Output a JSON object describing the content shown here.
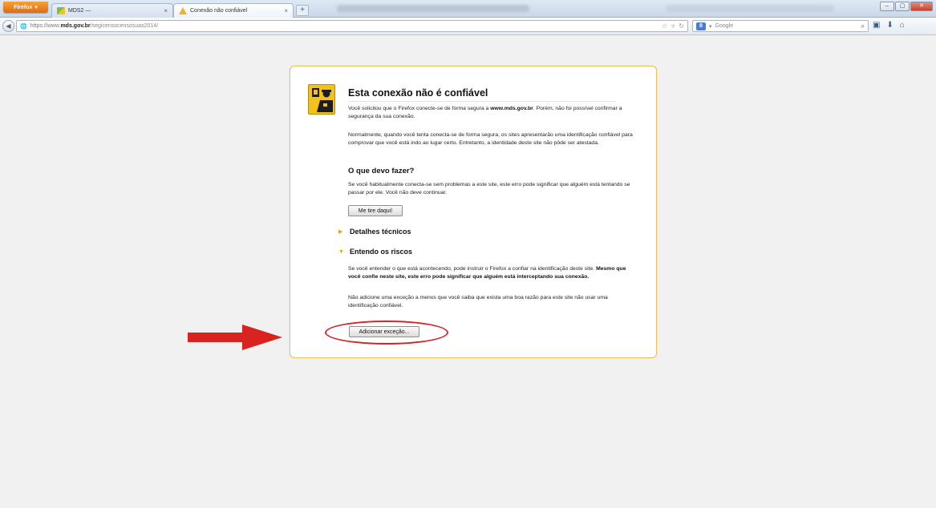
{
  "browser": {
    "menu_button": "Firefox",
    "tabs": [
      {
        "title": "MDS2 —",
        "close": "×"
      },
      {
        "title": "Conexão não confiável",
        "close": "×"
      }
    ],
    "new_tab": "+",
    "url": {
      "scheme": "https://www.",
      "host": "mds.gov.br",
      "path": "/segicensocensosuas2014/"
    },
    "search": {
      "engine": "Google"
    },
    "window_controls": {
      "minimize": "–",
      "maximize": "▢",
      "close": "✕"
    }
  },
  "error_page": {
    "title": "Esta conexão não é confiável",
    "intro_part1": "Você solicitou que o Firefox conecte-se de forma segura a ",
    "intro_domain": "www.mds.gov.br",
    "intro_part2": ". Porém, não foi possível confirmar a segurança da sua conexão.",
    "explanation": "Normalmente, quando você tenta conecta-se de forma segura, os sites apresentarão uma identificação confiável para comprovar que você está indo ao lugar certo. Entretanto, a identidade deste site não pôde ser atestada.",
    "what_heading": "O que devo fazer?",
    "what_text": "Se você habitualmente conecta-se sem problemas a este site, este erro pode significar que alguém está tentando se passar por ele. Você não deve continuar.",
    "get_me_out_button": "Me tire daqui!",
    "technical_details_label": "Detalhes técnicos",
    "understand_risks_label": "Entendo os riscos",
    "risks_text_part1": "Se você entender o que está acontecendo, pode instruir o Firefox a confiar na identificação deste site. ",
    "risks_text_bold": "Mesmo que você confie neste site, este erro pode significar que alguém está interceptando sua conexão.",
    "no_exception_text": "Não adicione uma exceção a menos que você saiba que exista uma boa razão para este site não usar uma identificação confiável.",
    "add_exception_button": "Adicionar exceção...",
    "annotation_color": "#d1262a"
  }
}
